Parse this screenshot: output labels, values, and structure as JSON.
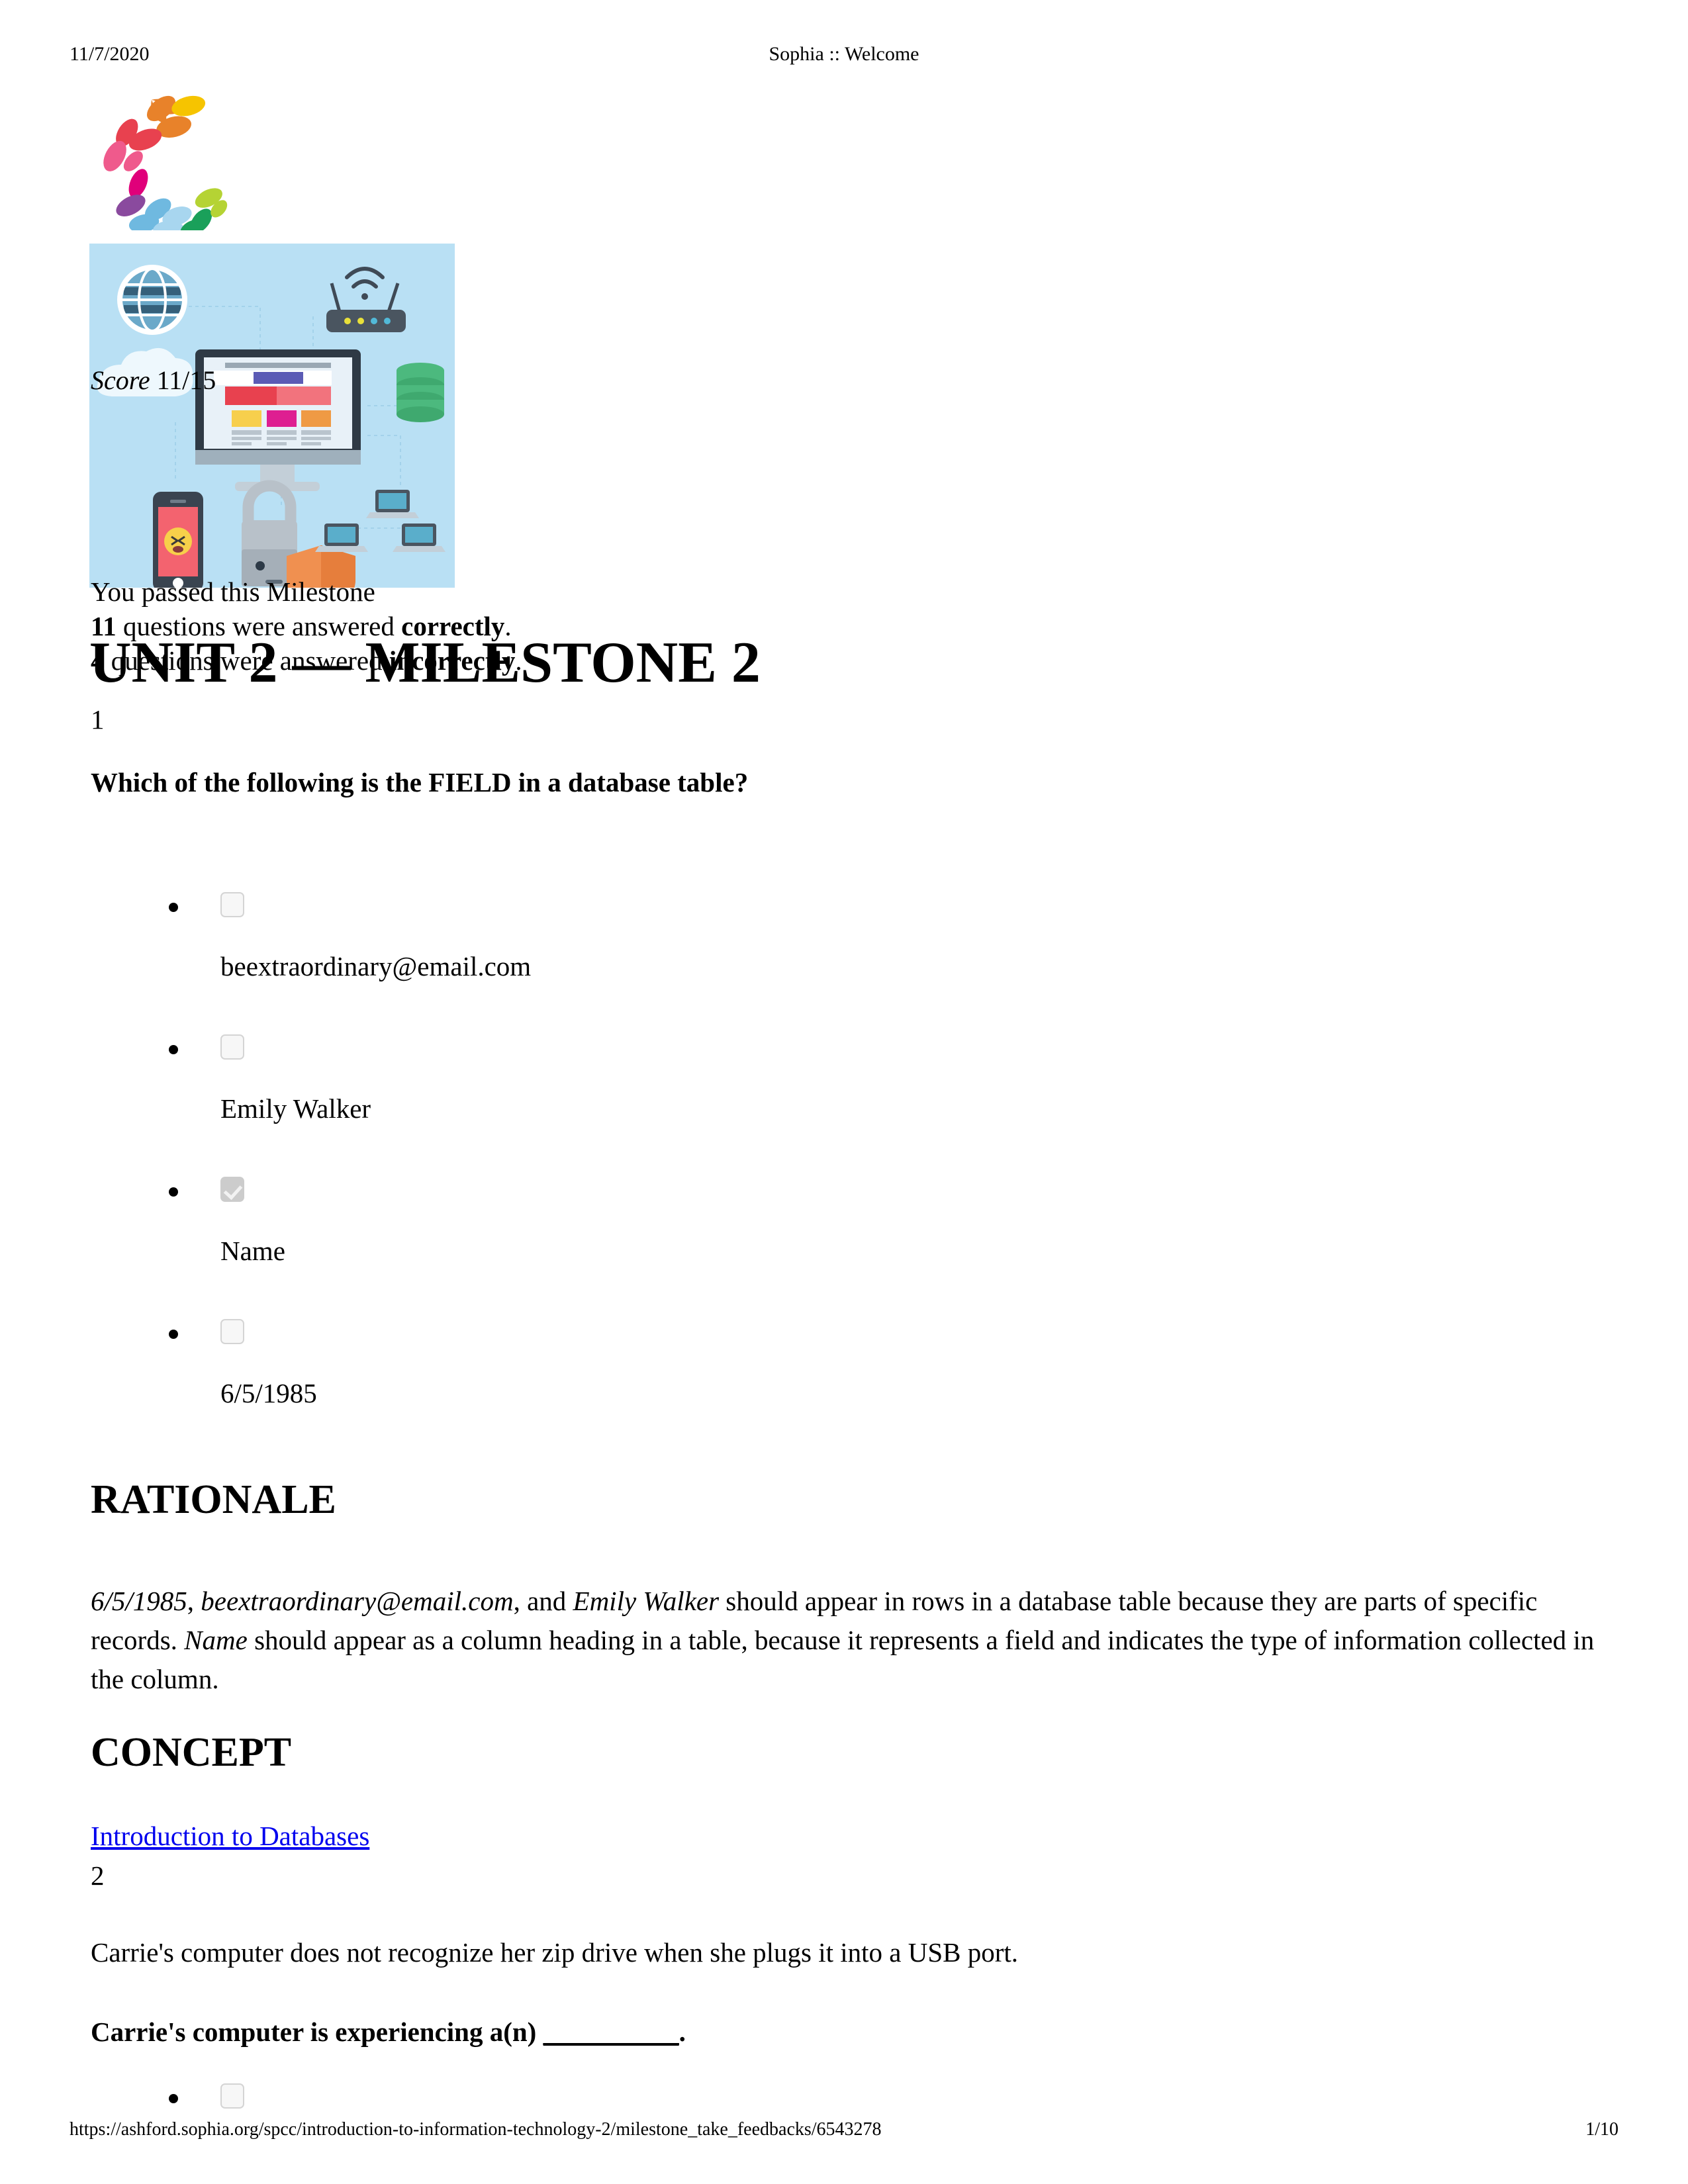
{
  "print": {
    "date": "11/7/2020",
    "title": "Sophia :: Welcome",
    "url": "https://ashford.sophia.org/spcc/introduction-to-information-technology-2/milestone_take_feedbacks/6543278",
    "page": "1/10"
  },
  "logo": {
    "name": "sophia-logo",
    "colors": [
      "#e8822a",
      "#f6c400",
      "#e8822a",
      "#e8414f",
      "#e8414f",
      "#ef5a8c",
      "#ef5a8c",
      "#e0007a",
      "#8a4a9e",
      "#6fb9e0",
      "#a8d6ef",
      "#a8d6ef",
      "#1aa05a",
      "#1aa05a",
      "#b5d334",
      "#b5d334"
    ]
  },
  "banner": {
    "alt": "information-technology-illustration",
    "background": "#b9e0f4"
  },
  "score": {
    "label": "Score",
    "value": "11/15"
  },
  "milestone": {
    "pass_text": "You passed this Milestone",
    "correct_count": "11",
    "correct_mid": " questions were answered ",
    "correct_word": "correctly",
    "correct_end": ".",
    "incorrect_count": "4",
    "incorrect_mid": " questions were answered ",
    "incorrect_word": "incorrectly",
    "incorrect_end": ".",
    "unit_title": "UNIT 2 — MILESTONE 2"
  },
  "questions": [
    {
      "number": "1",
      "prompt": "Which of the following is the FIELD in a database table?",
      "options": [
        {
          "label": "beextraordinary@email.com",
          "checked": false
        },
        {
          "label": "Emily Walker",
          "checked": false
        },
        {
          "label": "Name",
          "checked": true
        },
        {
          "label": "6/5/1985",
          "checked": false
        }
      ],
      "rationale_heading": "RATIONALE",
      "rationale": {
        "p1_i1": "6/5/1985",
        "p1_t1": ", ",
        "p1_i2": "beextraordinary@email.com",
        "p1_t2": ", and ",
        "p1_i3": "Emily Walker",
        "p1_t3": " should appear in rows in a database table because they are parts of specific records. ",
        "p1_i4": "Name",
        "p1_t4": " should appear as a column heading in a table, because it represents a field and indicates the type of information collected in the column."
      },
      "concept_heading": "CONCEPT",
      "concept_link": "Introduction to Databases"
    },
    {
      "number": "2",
      "stem": "Carrie's computer does not recognize her zip drive when she plugs it into a USB port.",
      "prompt_pre": "Carrie's computer is experiencing a(n) ",
      "prompt_blank": "__________",
      "prompt_post": ".",
      "options": [
        {
          "label": "",
          "checked": false
        }
      ]
    }
  ]
}
